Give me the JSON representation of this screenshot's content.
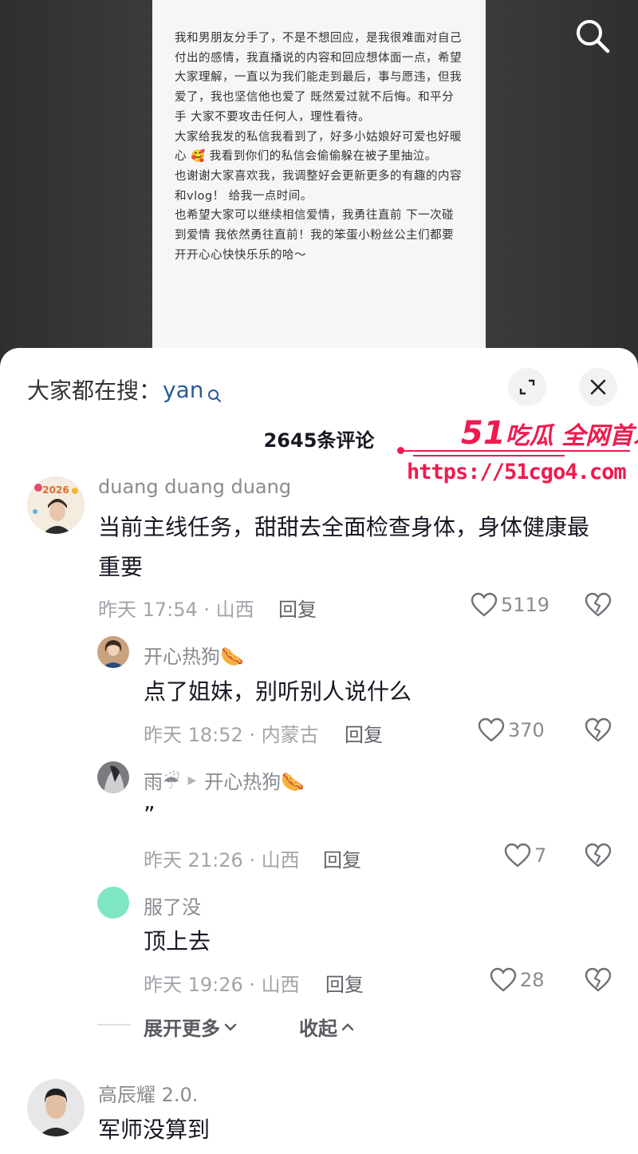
{
  "post": {
    "paragraphs": [
      "我和男朋友分手了，不是不想回应，是我很难面对自己付出的感情，我直播说的内容和回应想体面一点，希望大家理解，一直以为我们能走到最后，事与愿违，但我爱了，我也坚信他也爱了 既然爱过就不后悔。和平分手 大家不要攻击任何人，理性看待。",
      "大家给我发的私信我看到了，好多小姑娘好可爱也好暖心 🥰 我看到你们的私信会偷偷躲在被子里抽泣。",
      "也谢谢大家喜欢我，我调整好会更新更多的有趣的内容 和vlog！ 给我一点时间。",
      "也希望大家可以继续相信爱情，我勇往直前 下一次碰到爱情 我依然勇往直前！我的笨蛋小粉丝公主们都要开开心心快快乐乐的哈～"
    ]
  },
  "search": {
    "prefix": "大家都在搜：",
    "keyword": "yan"
  },
  "comments_header": {
    "count_label": "2645条评论"
  },
  "watermark": {
    "brand_num": "51",
    "brand_text": "吃瓜 全网首发",
    "url": "https://51cgo4.com"
  },
  "comments": [
    {
      "user": "duang duang duang",
      "text": "当前主线任务，甜甜去全面检查身体，身体健康最重要",
      "meta": "昨天 17:54 · 山西",
      "reply": "回复",
      "likes": "5119"
    },
    {
      "user": "开心热狗🌭",
      "text": "点了姐妹，别听别人说什么",
      "meta": "昨天 18:52 · 内蒙古",
      "reply": "回复",
      "likes": "370"
    },
    {
      "user": "雨☔",
      "reply_to": "开心热狗🌭",
      "text": "”",
      "meta": "昨天 21:26 · 山西",
      "reply": "回复",
      "likes": "7"
    },
    {
      "user": "服了没",
      "text": "顶上去",
      "meta": "昨天 19:26 · 山西",
      "reply": "回复",
      "likes": "28"
    },
    {
      "user": "高辰耀 2.0.",
      "text": "军师没算到"
    }
  ],
  "thread_controls": {
    "expand_more": "展开更多",
    "collapse": "收起"
  },
  "avatar_badge": "2026"
}
